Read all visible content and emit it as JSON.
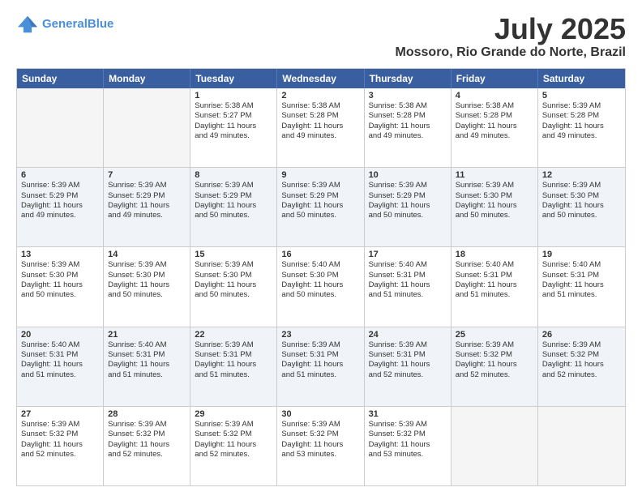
{
  "header": {
    "logo_line1": "General",
    "logo_line2": "Blue",
    "month": "July 2025",
    "location": "Mossoro, Rio Grande do Norte, Brazil"
  },
  "weekdays": [
    "Sunday",
    "Monday",
    "Tuesday",
    "Wednesday",
    "Thursday",
    "Friday",
    "Saturday"
  ],
  "rows": [
    [
      {
        "day": "",
        "lines": [],
        "empty": true
      },
      {
        "day": "",
        "lines": [],
        "empty": true
      },
      {
        "day": "1",
        "lines": [
          "Sunrise: 5:38 AM",
          "Sunset: 5:27 PM",
          "Daylight: 11 hours",
          "and 49 minutes."
        ]
      },
      {
        "day": "2",
        "lines": [
          "Sunrise: 5:38 AM",
          "Sunset: 5:28 PM",
          "Daylight: 11 hours",
          "and 49 minutes."
        ]
      },
      {
        "day": "3",
        "lines": [
          "Sunrise: 5:38 AM",
          "Sunset: 5:28 PM",
          "Daylight: 11 hours",
          "and 49 minutes."
        ]
      },
      {
        "day": "4",
        "lines": [
          "Sunrise: 5:38 AM",
          "Sunset: 5:28 PM",
          "Daylight: 11 hours",
          "and 49 minutes."
        ]
      },
      {
        "day": "5",
        "lines": [
          "Sunrise: 5:39 AM",
          "Sunset: 5:28 PM",
          "Daylight: 11 hours",
          "and 49 minutes."
        ]
      }
    ],
    [
      {
        "day": "6",
        "lines": [
          "Sunrise: 5:39 AM",
          "Sunset: 5:29 PM",
          "Daylight: 11 hours",
          "and 49 minutes."
        ]
      },
      {
        "day": "7",
        "lines": [
          "Sunrise: 5:39 AM",
          "Sunset: 5:29 PM",
          "Daylight: 11 hours",
          "and 49 minutes."
        ]
      },
      {
        "day": "8",
        "lines": [
          "Sunrise: 5:39 AM",
          "Sunset: 5:29 PM",
          "Daylight: 11 hours",
          "and 50 minutes."
        ]
      },
      {
        "day": "9",
        "lines": [
          "Sunrise: 5:39 AM",
          "Sunset: 5:29 PM",
          "Daylight: 11 hours",
          "and 50 minutes."
        ]
      },
      {
        "day": "10",
        "lines": [
          "Sunrise: 5:39 AM",
          "Sunset: 5:29 PM",
          "Daylight: 11 hours",
          "and 50 minutes."
        ]
      },
      {
        "day": "11",
        "lines": [
          "Sunrise: 5:39 AM",
          "Sunset: 5:30 PM",
          "Daylight: 11 hours",
          "and 50 minutes."
        ]
      },
      {
        "day": "12",
        "lines": [
          "Sunrise: 5:39 AM",
          "Sunset: 5:30 PM",
          "Daylight: 11 hours",
          "and 50 minutes."
        ]
      }
    ],
    [
      {
        "day": "13",
        "lines": [
          "Sunrise: 5:39 AM",
          "Sunset: 5:30 PM",
          "Daylight: 11 hours",
          "and 50 minutes."
        ]
      },
      {
        "day": "14",
        "lines": [
          "Sunrise: 5:39 AM",
          "Sunset: 5:30 PM",
          "Daylight: 11 hours",
          "and 50 minutes."
        ]
      },
      {
        "day": "15",
        "lines": [
          "Sunrise: 5:39 AM",
          "Sunset: 5:30 PM",
          "Daylight: 11 hours",
          "and 50 minutes."
        ]
      },
      {
        "day": "16",
        "lines": [
          "Sunrise: 5:40 AM",
          "Sunset: 5:30 PM",
          "Daylight: 11 hours",
          "and 50 minutes."
        ]
      },
      {
        "day": "17",
        "lines": [
          "Sunrise: 5:40 AM",
          "Sunset: 5:31 PM",
          "Daylight: 11 hours",
          "and 51 minutes."
        ]
      },
      {
        "day": "18",
        "lines": [
          "Sunrise: 5:40 AM",
          "Sunset: 5:31 PM",
          "Daylight: 11 hours",
          "and 51 minutes."
        ]
      },
      {
        "day": "19",
        "lines": [
          "Sunrise: 5:40 AM",
          "Sunset: 5:31 PM",
          "Daylight: 11 hours",
          "and 51 minutes."
        ]
      }
    ],
    [
      {
        "day": "20",
        "lines": [
          "Sunrise: 5:40 AM",
          "Sunset: 5:31 PM",
          "Daylight: 11 hours",
          "and 51 minutes."
        ]
      },
      {
        "day": "21",
        "lines": [
          "Sunrise: 5:40 AM",
          "Sunset: 5:31 PM",
          "Daylight: 11 hours",
          "and 51 minutes."
        ]
      },
      {
        "day": "22",
        "lines": [
          "Sunrise: 5:39 AM",
          "Sunset: 5:31 PM",
          "Daylight: 11 hours",
          "and 51 minutes."
        ]
      },
      {
        "day": "23",
        "lines": [
          "Sunrise: 5:39 AM",
          "Sunset: 5:31 PM",
          "Daylight: 11 hours",
          "and 51 minutes."
        ]
      },
      {
        "day": "24",
        "lines": [
          "Sunrise: 5:39 AM",
          "Sunset: 5:31 PM",
          "Daylight: 11 hours",
          "and 52 minutes."
        ]
      },
      {
        "day": "25",
        "lines": [
          "Sunrise: 5:39 AM",
          "Sunset: 5:32 PM",
          "Daylight: 11 hours",
          "and 52 minutes."
        ]
      },
      {
        "day": "26",
        "lines": [
          "Sunrise: 5:39 AM",
          "Sunset: 5:32 PM",
          "Daylight: 11 hours",
          "and 52 minutes."
        ]
      }
    ],
    [
      {
        "day": "27",
        "lines": [
          "Sunrise: 5:39 AM",
          "Sunset: 5:32 PM",
          "Daylight: 11 hours",
          "and 52 minutes."
        ]
      },
      {
        "day": "28",
        "lines": [
          "Sunrise: 5:39 AM",
          "Sunset: 5:32 PM",
          "Daylight: 11 hours",
          "and 52 minutes."
        ]
      },
      {
        "day": "29",
        "lines": [
          "Sunrise: 5:39 AM",
          "Sunset: 5:32 PM",
          "Daylight: 11 hours",
          "and 52 minutes."
        ]
      },
      {
        "day": "30",
        "lines": [
          "Sunrise: 5:39 AM",
          "Sunset: 5:32 PM",
          "Daylight: 11 hours",
          "and 53 minutes."
        ]
      },
      {
        "day": "31",
        "lines": [
          "Sunrise: 5:39 AM",
          "Sunset: 5:32 PM",
          "Daylight: 11 hours",
          "and 53 minutes."
        ]
      },
      {
        "day": "",
        "lines": [],
        "empty": true
      },
      {
        "day": "",
        "lines": [],
        "empty": true
      }
    ]
  ]
}
